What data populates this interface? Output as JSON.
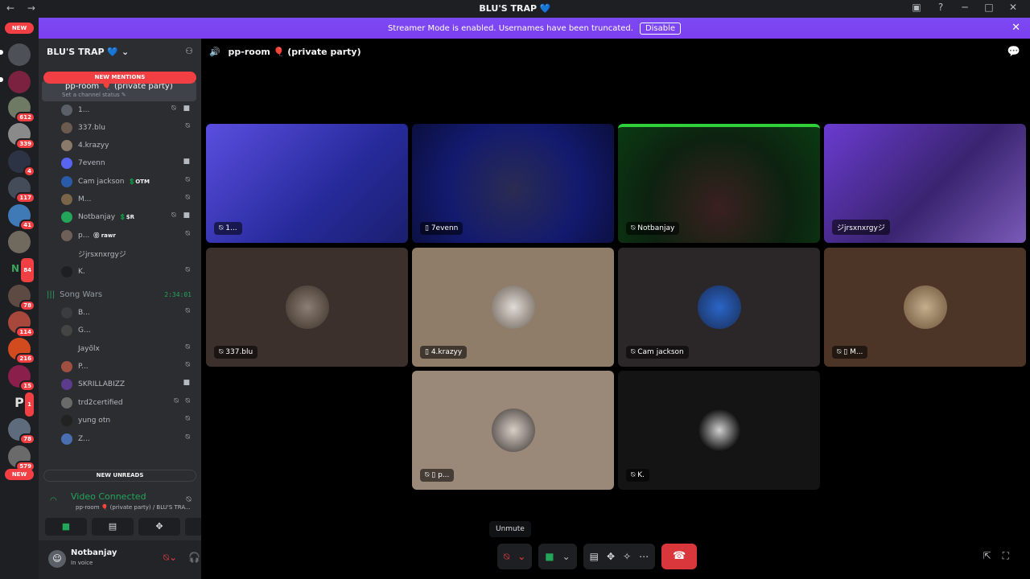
{
  "window": {
    "title": "BLU'S TRAP 💙"
  },
  "banner": {
    "message": "Streamer Mode is enabled. Usernames have been truncated.",
    "disable_label": "Disable"
  },
  "guild_rail": {
    "new_label": "NEW",
    "badges": [
      "612",
      "339",
      "4",
      "117",
      "41",
      "84",
      "78",
      "114",
      "216",
      "15",
      "1",
      "78",
      "579"
    ],
    "bottom_new_label": "NEW"
  },
  "sidebar": {
    "server_name": "BLU'S TRAP 💙",
    "new_mentions_label": "NEW MENTIONS",
    "new_unreads_label": "NEW UNREADS",
    "active_channel": {
      "name": "pp-room 🎈 (private party)",
      "status_placeholder": "Set a channel status ✎"
    },
    "members": [
      {
        "name": "1...",
        "tag": "",
        "icons": "⍉ ■"
      },
      {
        "name": "337.blu",
        "tag": "",
        "icons": "⍉"
      },
      {
        "name": "4.krazyy",
        "tag": "",
        "icons": ""
      },
      {
        "name": "7evenn",
        "tag": "",
        "icons": "■"
      },
      {
        "name": "Cam jackson",
        "tag": "💲OTM",
        "icons": "⍉"
      },
      {
        "name": "M...",
        "tag": "",
        "icons": "⍉"
      },
      {
        "name": "Notbanjay",
        "tag": "💲$R",
        "icons": "⍉ ■"
      },
      {
        "name": "p...",
        "tag": "⓪ rawr",
        "icons": "⍉"
      },
      {
        "name": "ジjrsxnxrgyジ",
        "tag": "",
        "icons": ""
      },
      {
        "name": "K.",
        "tag": "",
        "icons": "⍉"
      }
    ],
    "song_wars": {
      "name": "Song Wars",
      "timer": "2:34:01"
    },
    "song_wars_members": [
      {
        "name": "B...",
        "icons": "⍉"
      },
      {
        "name": "G...",
        "icons": ""
      },
      {
        "name": "Jayõlx",
        "icons": "⍉"
      },
      {
        "name": "P...",
        "icons": "⍉"
      },
      {
        "name": "SKRILLABIZZ",
        "icons": "■"
      },
      {
        "name": "trd2certified",
        "icons": "⍉ ⍉"
      },
      {
        "name": "yung otn",
        "icons": "⍉"
      },
      {
        "name": "Z...",
        "icons": "⍉"
      }
    ]
  },
  "voice_panel": {
    "status": "Video Connected",
    "location": "pp-room 🎈 (private party) / BLU'S TRA..."
  },
  "user_panel": {
    "name": "Notbanjay",
    "status": "In voice"
  },
  "stage": {
    "channel_title": "pp-room 🎈 (private party)",
    "tiles": [
      {
        "label": "⍉ 1...",
        "bg": "#3a3cd0",
        "video": true
      },
      {
        "label": "▯ 7evenn",
        "bg": "#151a6a",
        "video": true
      },
      {
        "label": "⍉ Notbanjay",
        "bg": "#0e2a12",
        "video": true
      },
      {
        "label": "ジjrsxnxrgyジ",
        "bg": "#4b2a8e",
        "video": true
      },
      {
        "label": "⍉ 337.blu",
        "bg": "#3b302c",
        "avatar": "#5a5048"
      },
      {
        "label": "▯ 4.krazyy",
        "bg": "#8f7c69",
        "avatar": "#b2a698"
      },
      {
        "label": "⍉ Cam jackson",
        "bg": "#2b2729",
        "avatar": "#2457a8"
      },
      {
        "label": "⍉ ▯ M...",
        "bg": "#4c3526",
        "avatar": "#a78f6e"
      },
      {
        "label": "⍉ ▯ p...",
        "bg": "#9a8878",
        "avatar": "#8a7a6c"
      },
      {
        "label": "⍉ K.",
        "bg": "#141414",
        "avatar": "#3a3a3a"
      }
    ],
    "tooltip": "Unmute"
  },
  "colors": {
    "accent": "#5865f2",
    "danger": "#da373c",
    "online": "#23a55a",
    "banner": "#7b4af2"
  }
}
